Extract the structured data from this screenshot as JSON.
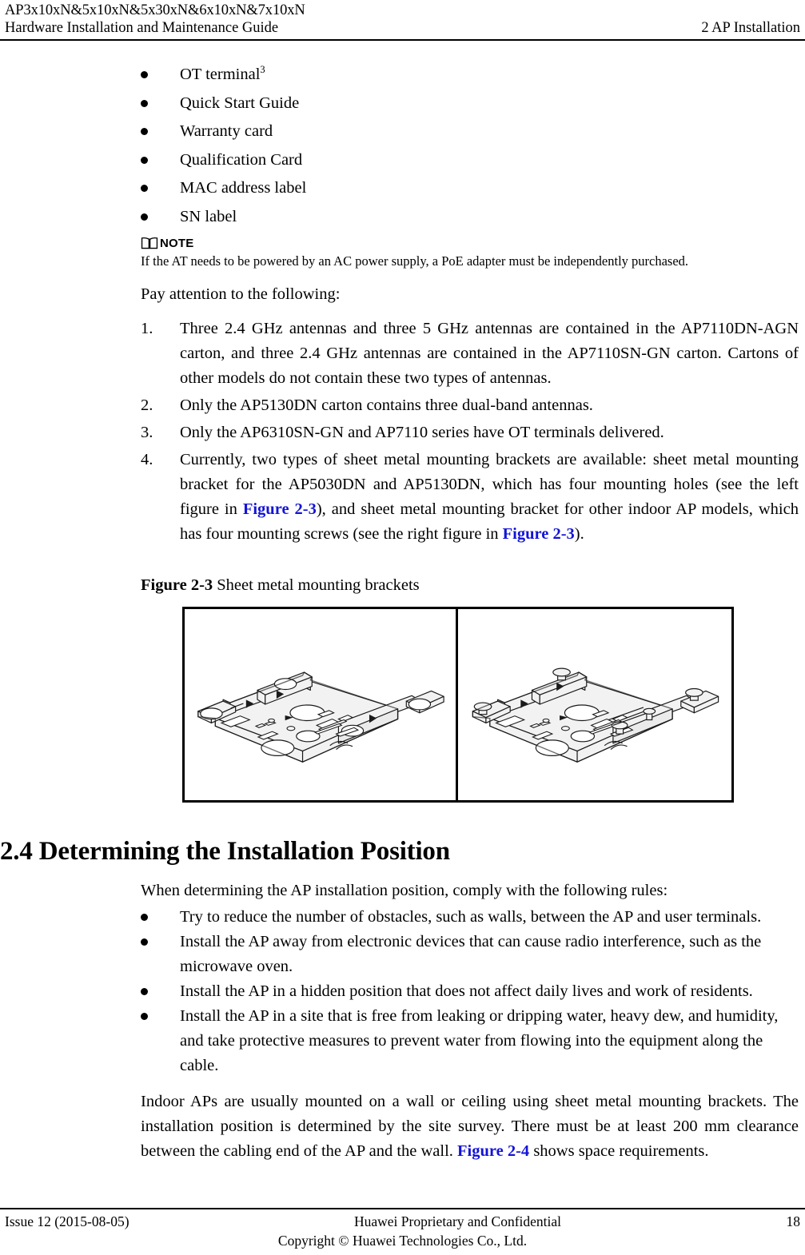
{
  "header": {
    "product_line": "AP3x10xN&5x10xN&5x30xN&6x10xN&7x10xN",
    "guide_title": "Hardware Installation and Maintenance Guide",
    "chapter": "2 AP Installation"
  },
  "packing_list": {
    "items": [
      {
        "text": "OT terminal",
        "superscript": "3"
      },
      {
        "text": "Quick Start Guide",
        "superscript": ""
      },
      {
        "text": "Warranty card",
        "superscript": ""
      },
      {
        "text": "Qualification Card",
        "superscript": ""
      },
      {
        "text": "MAC address label",
        "superscript": ""
      },
      {
        "text": "SN label",
        "superscript": ""
      }
    ]
  },
  "note": {
    "icon": "open-book-icon",
    "label": "NOTE",
    "body": "If the AT needs to be powered by an AC power supply, a PoE adapter must be independently purchased."
  },
  "attention": {
    "lead_in": "Pay attention to the following:",
    "items": [
      {
        "number": "1.",
        "parts": [
          {
            "type": "text",
            "value": "Three 2.4 GHz antennas and three 5 GHz antennas are contained in the AP7110DN-AGN carton, and three 2.4 GHz antennas are contained in the AP7110SN-GN carton. Cartons of other models do not contain these two types of antennas."
          }
        ]
      },
      {
        "number": "2.",
        "parts": [
          {
            "type": "text",
            "value": "Only the AP5130DN carton contains three dual-band antennas."
          }
        ]
      },
      {
        "number": "3.",
        "parts": [
          {
            "type": "text",
            "value": "Only the AP6310SN-GN and AP7110 series have OT terminals delivered."
          }
        ]
      },
      {
        "number": "4.",
        "parts": [
          {
            "type": "text",
            "value": "Currently, two types of sheet metal mounting brackets are available: sheet metal mounting bracket for the AP5030DN and AP5130DN, which has four mounting holes (see the left figure in "
          },
          {
            "type": "xref",
            "value": "Figure 2-3"
          },
          {
            "type": "text",
            "value": "), and sheet metal mounting bracket for other indoor AP models, which has four mounting screws (see the right figure in "
          },
          {
            "type": "xref",
            "value": "Figure 2-3"
          },
          {
            "type": "text",
            "value": ")."
          }
        ]
      }
    ]
  },
  "figure": {
    "label": "Figure 2-3",
    "caption": "Sheet metal mounting brackets",
    "left_panel_alt": "sheet-metal-bracket-with-mounting-holes",
    "right_panel_alt": "sheet-metal-bracket-with-mounting-screws"
  },
  "section": {
    "heading": "2.4 Determining the Installation Position",
    "lead_in": "When determining the AP installation position, comply with the following rules:",
    "rules": [
      "Try to reduce the number of obstacles, such as walls, between the AP and user terminals.",
      "Install the AP away from electronic devices that can cause radio interference, such as the microwave oven.",
      "Install the AP in a hidden position that does not affect daily lives and work of residents.",
      "Install the AP in a site that is free from leaking or dripping water, heavy dew, and humidity, and take protective measures to prevent water from flowing into the equipment along the cable."
    ],
    "closing_paragraph": [
      {
        "type": "text",
        "value": "Indoor APs are usually mounted on a wall or ceiling using sheet metal mounting brackets. The installation position is determined by the site survey. There must be at least 200 mm clearance between the cabling end of the AP and the wall. "
      },
      {
        "type": "xref",
        "value": "Figure 2-4"
      },
      {
        "type": "text",
        "value": " shows space requirements."
      }
    ]
  },
  "footer": {
    "issue": "Issue 12 (2015-08-05)",
    "confidential_line1": "Huawei Proprietary and Confidential",
    "confidential_line2": "Copyright © Huawei Technologies Co., Ltd.",
    "page_number": "18"
  },
  "colors": {
    "link_blue": "#1313d8",
    "text_black": "#000000",
    "page_background": "#ffffff"
  }
}
